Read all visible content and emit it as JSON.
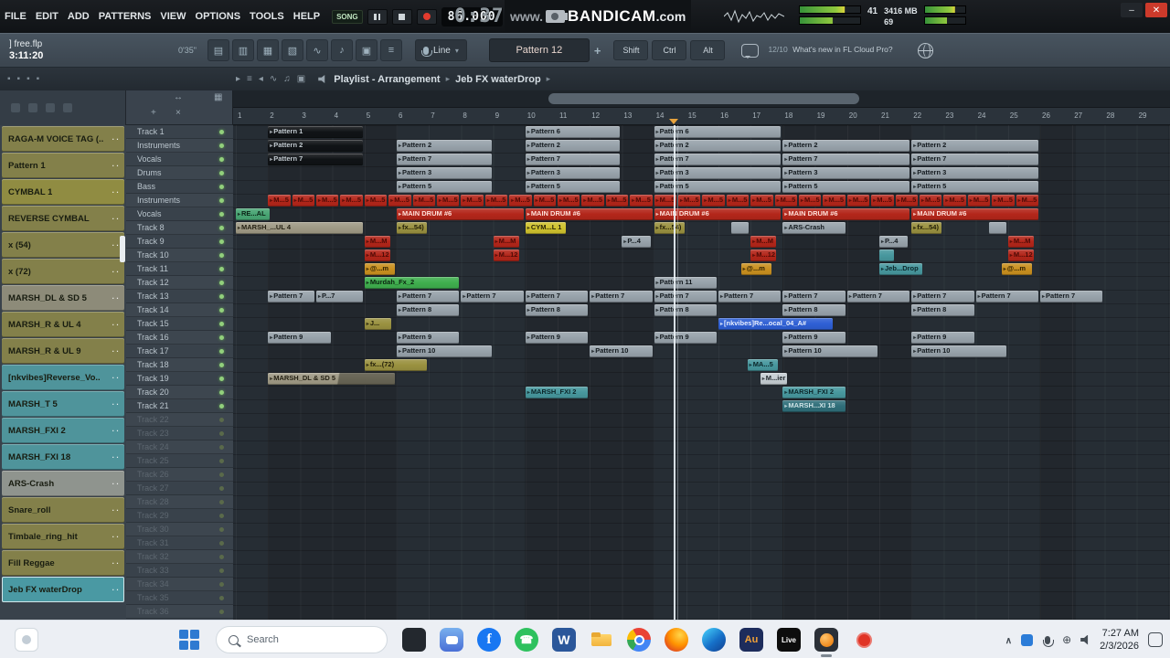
{
  "menu": {
    "items": [
      "FILE",
      "EDIT",
      "ADD",
      "PATTERNS",
      "VIEW",
      "OPTIONS",
      "TOOLS",
      "HELP"
    ]
  },
  "transport": {
    "mode_label": "SONG",
    "tempo": "86.000",
    "timecode": "0:37:99"
  },
  "bandicam": {
    "prefix": "www.",
    "brand": "BANDICAM",
    "suffix": ".com"
  },
  "meters": {
    "left_value": "41",
    "memory": "3416 MB",
    "right_value": "69"
  },
  "toolbar": {
    "file_name": "] free.flp",
    "rec_time": "3:11:20",
    "song_length": "0'35\"",
    "icons": [
      "overview",
      "browser",
      "grid",
      "layers",
      "wave",
      "notes",
      "panel",
      "list"
    ],
    "snap_mode": "Line",
    "pattern_name": "Pattern 12",
    "pattern_add": "+",
    "modifier_keys": [
      "Shift",
      "Ctrl",
      "Alt"
    ],
    "hint_badge": "12/10",
    "hint_text": "What's new in FL Cloud Pro?"
  },
  "playlist": {
    "title": "Playlist - Arrangement",
    "separator": "▸",
    "subtitle": "Jeb FX waterDrop",
    "tools": [
      "pointer",
      "list",
      "cut",
      "wave",
      "note",
      "box"
    ]
  },
  "timeline": {
    "bars": [
      1,
      2,
      3,
      4,
      5,
      6,
      7,
      8,
      9,
      10,
      11,
      12,
      13,
      14,
      15,
      16,
      17,
      18,
      19,
      20,
      21,
      22,
      23,
      24,
      25,
      26,
      27,
      28,
      29
    ],
    "playhead_bar": 14.6
  },
  "channels": [
    {
      "label": "RAGA-M VOICE TAG (..",
      "color": "#83804a"
    },
    {
      "label": "Pattern 1",
      "color": "#83804a"
    },
    {
      "label": "CYMBAL 1",
      "color": "#908c42"
    },
    {
      "label": "REVERSE CYMBAL",
      "color": "#83804a"
    },
    {
      "label": "x (54)",
      "color": "#83804a"
    },
    {
      "label": "x (72)",
      "color": "#83804a"
    },
    {
      "label": "MARSH_DL & SD 5",
      "color": "#8d8b79"
    },
    {
      "label": "MARSH_R & UL 4",
      "color": "#83804a"
    },
    {
      "label": "MARSH_R & UL 9",
      "color": "#83804a"
    },
    {
      "label": "[nkvibes]Reverse_Vo..",
      "color": "#4f949b"
    },
    {
      "label": "MARSH_T 5",
      "color": "#4f949b"
    },
    {
      "label": "MARSH_FXI 2",
      "color": "#4f949b"
    },
    {
      "label": "MARSH_FXI 18",
      "color": "#4f949b"
    },
    {
      "label": "ARS-Crash",
      "color": "#8f948e"
    },
    {
      "label": "Snare_roll",
      "color": "#83804a"
    },
    {
      "label": "Timbale_ring_hit",
      "color": "#83804a"
    },
    {
      "label": "Fill Reggae",
      "color": "#83804a"
    },
    {
      "label": "Jeb FX waterDrop",
      "color": "#4a99a3",
      "selected": true
    }
  ],
  "tracks": {
    "names": [
      "Track 1",
      "Instruments",
      "Vocals",
      "Drums",
      "Bass",
      "Instruments",
      "Vocals",
      "Track 8",
      "Track 9",
      "Track 10",
      "Track 11",
      "Track 12",
      "Track 13",
      "Track 14",
      "Track 15",
      "Track 16",
      "Track 17",
      "Track 18",
      "Track 19",
      "Track 20",
      "Track 21",
      "Track 22",
      "Track 23",
      "Track 24",
      "Track 25",
      "Track 26",
      "Track 27",
      "Track 28",
      "Track 29",
      "Track 30",
      "Track 31",
      "Track 32",
      "Track 33",
      "Track 34",
      "Track 35",
      "Track 36"
    ],
    "dim_from": 21
  },
  "palette": {
    "gray": {
      "bg": "#97a2aa",
      "tx": "#141a1f"
    },
    "black": {
      "bg": "#101316",
      "tx": "#c2cad0"
    },
    "red": {
      "bg": "#b3261a",
      "tx": "#ffe1da"
    },
    "red2": {
      "bg": "#b3261a",
      "tx": "#4e0b06"
    },
    "olive": {
      "bg": "#9a9140",
      "tx": "#201d08"
    },
    "yellow": {
      "bg": "#cfc22e",
      "tx": "#2a2508"
    },
    "green": {
      "bg": "#3fae4e",
      "tx": "#0b2410"
    },
    "mint": {
      "bg": "#48a573",
      "tx": "#0c2417"
    },
    "teal": {
      "bg": "#47979e",
      "tx": "#0c2629"
    },
    "darkteal": {
      "bg": "#2f6e79",
      "tx": "#cfe3e6"
    },
    "orange": {
      "bg": "#c9901f",
      "tx": "#2e2104"
    },
    "blue": {
      "bg": "#2e5fd4",
      "tx": "#eaf0fd"
    },
    "tan": {
      "bg": "#9f9a85",
      "tx": "#242013"
    },
    "light": {
      "bg": "#c5cdd2",
      "tx": "#22292e"
    }
  },
  "clips": [
    {
      "row": 0,
      "bar": 2,
      "len": 3,
      "c": "black",
      "t": "Pattern 1"
    },
    {
      "row": 0,
      "bar": 10,
      "len": 3,
      "c": "gray",
      "t": "Pattern 6"
    },
    {
      "row": 0,
      "bar": 14,
      "len": 4,
      "c": "gray",
      "t": "Pattern 6"
    },
    {
      "row": 1,
      "bar": 2,
      "len": 3,
      "c": "black",
      "t": "Pattern 2"
    },
    {
      "row": 1,
      "bar": 6,
      "len": 3,
      "c": "gray",
      "t": "Pattern 2",
      "count": 2,
      "stride": 4
    },
    {
      "row": 1,
      "bar": 14,
      "len": 4,
      "c": "gray",
      "t": "Pattern 2",
      "count": 3,
      "stride": 4
    },
    {
      "row": 2,
      "bar": 2,
      "len": 3,
      "c": "black",
      "t": "Pattern 7"
    },
    {
      "row": 2,
      "bar": 6,
      "len": 3,
      "c": "gray",
      "t": "Pattern 7",
      "count": 2,
      "stride": 4
    },
    {
      "row": 2,
      "bar": 14,
      "len": 4,
      "c": "gray",
      "t": "Pattern 7",
      "count": 3,
      "stride": 4
    },
    {
      "row": 3,
      "bar": 6,
      "len": 3,
      "c": "gray",
      "t": "Pattern 3",
      "count": 2,
      "stride": 4
    },
    {
      "row": 3,
      "bar": 14,
      "len": 4,
      "c": "gray",
      "t": "Pattern 3",
      "count": 3,
      "stride": 4
    },
    {
      "row": 4,
      "bar": 6,
      "len": 3,
      "c": "gray",
      "t": "Pattern 5",
      "count": 2,
      "stride": 4
    },
    {
      "row": 4,
      "bar": 14,
      "len": 4,
      "c": "gray",
      "t": "Pattern 5",
      "count": 3,
      "stride": 4
    },
    {
      "row": 5,
      "bar": 2,
      "len": 0.75,
      "c": "red2",
      "t": "M...5",
      "count": 32
    },
    {
      "row": 6,
      "bar": 1,
      "len": 1.1,
      "c": "mint",
      "t": "RE...AL"
    },
    {
      "row": 6,
      "bar": 6,
      "len": 4,
      "c": "red",
      "t": "MAIN DRUM #6",
      "count": 5
    },
    {
      "row": 7,
      "bar": 1,
      "len": 4,
      "c": "tan",
      "t": "MARSH_...UL 4"
    },
    {
      "row": 7,
      "bar": 6,
      "len": 1,
      "c": "olive",
      "t": "fx...54)"
    },
    {
      "row": 7,
      "bar": 10,
      "len": 1.3,
      "c": "yellow",
      "t": "CYM...L 1"
    },
    {
      "row": 7,
      "bar": 14,
      "len": 1,
      "c": "olive",
      "t": "fx...54)"
    },
    {
      "row": 7,
      "bar": 16.4,
      "len": 0.6,
      "c": "gray",
      "t": ""
    },
    {
      "row": 7,
      "bar": 18,
      "len": 2,
      "c": "gray",
      "t": "ARS-Crash"
    },
    {
      "row": 7,
      "bar": 22,
      "len": 1,
      "c": "olive",
      "t": "fx...54)"
    },
    {
      "row": 7,
      "bar": 24.4,
      "len": 0.6,
      "c": "gray",
      "t": ""
    },
    {
      "row": 8,
      "bar": 5,
      "len": 0.85,
      "c": "red2",
      "t": "M...M"
    },
    {
      "row": 8,
      "bar": 9,
      "len": 0.85,
      "c": "red2",
      "t": "M...M"
    },
    {
      "row": 8,
      "bar": 13,
      "len": 0.95,
      "c": "gray",
      "t": "P...4"
    },
    {
      "row": 8,
      "bar": 17,
      "len": 0.85,
      "c": "red2",
      "t": "M...M"
    },
    {
      "row": 8,
      "bar": 21,
      "len": 0.95,
      "c": "gray",
      "t": "P...4"
    },
    {
      "row": 8,
      "bar": 25,
      "len": 0.85,
      "c": "red2",
      "t": "M...M"
    },
    {
      "row": 9,
      "bar": 5,
      "len": 0.85,
      "c": "red2",
      "t": "M...12"
    },
    {
      "row": 9,
      "bar": 9,
      "len": 0.85,
      "c": "red2",
      "t": "M...12"
    },
    {
      "row": 9,
      "bar": 17,
      "len": 0.85,
      "c": "red2",
      "t": "M...12"
    },
    {
      "row": 9,
      "bar": 21,
      "len": 0.5,
      "c": "teal",
      "t": ""
    },
    {
      "row": 9,
      "bar": 25,
      "len": 0.85,
      "c": "red2",
      "t": "M...12"
    },
    {
      "row": 10,
      "bar": 5,
      "len": 1,
      "c": "orange",
      "t": "@...m"
    },
    {
      "row": 10,
      "bar": 16.7,
      "len": 1,
      "c": "orange",
      "t": "@...m"
    },
    {
      "row": 10,
      "bar": 21,
      "len": 1.4,
      "c": "teal",
      "t": "Jeb...Drop"
    },
    {
      "row": 10,
      "bar": 24.8,
      "len": 1,
      "c": "orange",
      "t": "@...m"
    },
    {
      "row": 11,
      "bar": 5,
      "len": 3,
      "c": "green",
      "t": "Murdah_Fx_2"
    },
    {
      "row": 11,
      "bar": 14,
      "len": 2,
      "c": "gray",
      "t": "Pattern 11"
    },
    {
      "row": 12,
      "bar": 2,
      "len": 1.5,
      "c": "gray",
      "t": "Pattern 7"
    },
    {
      "row": 12,
      "bar": 3.5,
      "len": 1.5,
      "c": "gray",
      "t": "P...7"
    },
    {
      "row": 12,
      "bar": 6,
      "len": 2,
      "c": "gray",
      "t": "Pattern 7",
      "count": 11
    },
    {
      "row": 13,
      "bar": 6,
      "len": 2,
      "c": "gray",
      "t": "Pattern 8",
      "count": 5,
      "stride": 4
    },
    {
      "row": 14,
      "bar": 5,
      "len": 0.9,
      "c": "olive",
      "t": "J..."
    },
    {
      "row": 14,
      "bar": 16,
      "len": 3.6,
      "c": "blue",
      "t": "[nkvibes]Re...ocal_04_A#"
    },
    {
      "row": 15,
      "bar": 2,
      "len": 2,
      "c": "gray",
      "t": "Pattern 9",
      "count": 6,
      "stride": 4
    },
    {
      "row": 16,
      "bar": 6,
      "len": 3,
      "c": "gray",
      "t": "Pattern 10"
    },
    {
      "row": 16,
      "bar": 12,
      "len": 2,
      "c": "gray",
      "t": "Pattern 10"
    },
    {
      "row": 16,
      "bar": 18,
      "len": 3,
      "c": "gray",
      "t": "Pattern 10"
    },
    {
      "row": 16,
      "bar": 22,
      "len": 3,
      "c": "gray",
      "t": "Pattern 10"
    },
    {
      "row": 17,
      "bar": 5,
      "len": 2,
      "c": "olive",
      "t": "fx...(72)"
    },
    {
      "row": 17,
      "bar": 16.9,
      "len": 1,
      "c": "teal",
      "t": "MA...5"
    },
    {
      "row": 18,
      "bar": 2,
      "len": 4,
      "c": "tan",
      "t": "MARSH_DL & SD 5",
      "fade": true
    },
    {
      "row": 18,
      "bar": 17.3,
      "len": 0.9,
      "c": "light",
      "t": "M...ier"
    },
    {
      "row": 19,
      "bar": 10,
      "len": 2,
      "c": "teal",
      "t": "MARSH_FXI 2"
    },
    {
      "row": 19,
      "bar": 18,
      "len": 2,
      "c": "teal",
      "t": "MARSH_FXI 2"
    },
    {
      "row": 20,
      "bar": 18,
      "len": 2,
      "c": "darkteal",
      "t": "MARSH...XI 18"
    }
  ],
  "taskbar": {
    "search_placeholder": "Search",
    "apps": [
      {
        "kind": "dark"
      },
      {
        "kind": "chat"
      },
      {
        "kind": "facebook",
        "letter": "f"
      },
      {
        "kind": "whatsapp"
      },
      {
        "kind": "word",
        "letter": "W"
      },
      {
        "kind": "folder"
      },
      {
        "kind": "chrome"
      },
      {
        "kind": "firefox"
      },
      {
        "kind": "edge"
      },
      {
        "kind": "audacity",
        "letter": "Au"
      },
      {
        "kind": "live",
        "letter": "Live"
      },
      {
        "kind": "flstudio",
        "active": true
      },
      {
        "kind": "record"
      }
    ],
    "clock": {
      "time": "7:27 AM",
      "date": "2/3/2026"
    }
  }
}
